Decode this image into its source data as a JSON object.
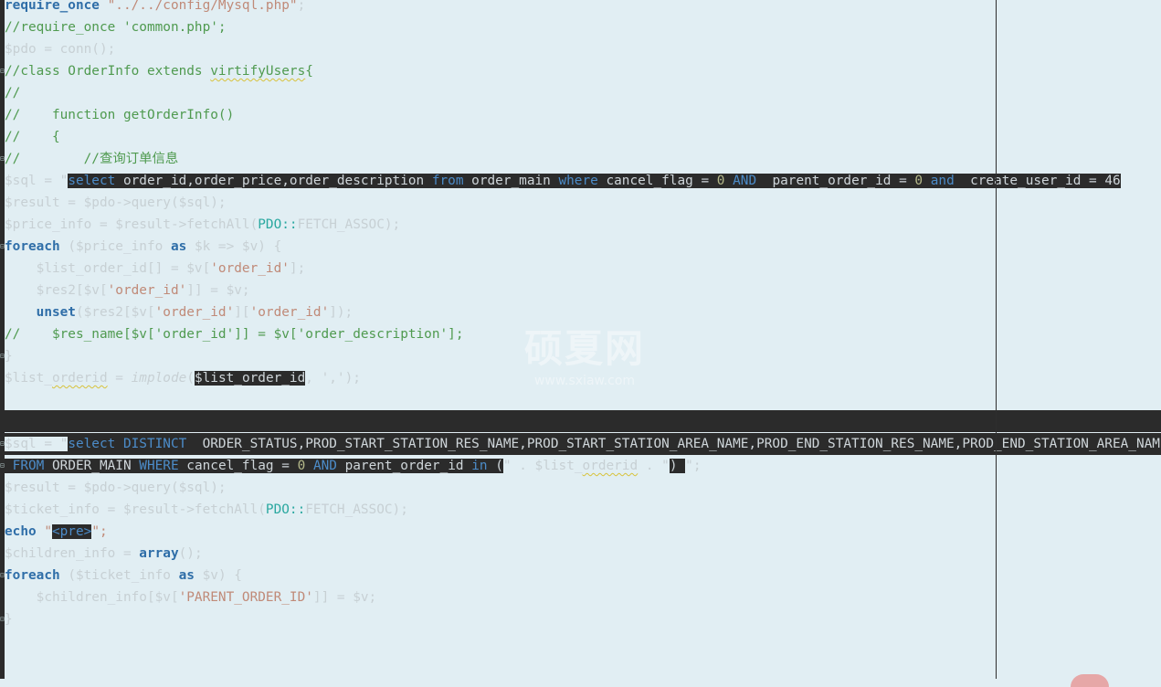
{
  "editor": {
    "language": "PHP",
    "lines": {
      "l1": {
        "kw": "require_once",
        "str": " \"../../config/Mysql.php\"",
        "end": ";"
      },
      "l2": {
        "comment": "//require_once 'common.php';"
      },
      "l3": {
        "text": "$pdo = conn();"
      },
      "l4": {
        "comment_a": "//class OrderInfo extends ",
        "comment_b": "virtifyUsers",
        "comment_c": "{"
      },
      "l5": {
        "comment": "//"
      },
      "l6": {
        "comment": "//    function getOrderInfo()"
      },
      "l7": {
        "comment": "//    {"
      },
      "l8": {
        "comment": "//        //查询订单信息"
      },
      "l9": {
        "pre": "$sql = \"",
        "sel_a": "select",
        "sel_b": " order_id,order_price,order_description ",
        "sel_c": "from",
        "sel_d": " order_main ",
        "sel_e": "where",
        "sel_f": " cancel_flag = ",
        "sel_g": "0",
        "sel_h": " ",
        "sel_i": "AND",
        "sel_j": "  parent_order_id = ",
        "sel_k": "0",
        "sel_l": " ",
        "sel_m": "and",
        "sel_n": "  create_user_id = 46"
      },
      "l10": {
        "a": "$result = $pdo->query($sql);"
      },
      "l11": {
        "a": "$price_info = $result->fetchAll(",
        "cls": "PDO::",
        "b": "FETCH_ASSOC);"
      },
      "l12": {
        "kw": "foreach",
        "a": " ($price_info ",
        "as": "as",
        "b": " $k => $v) {"
      },
      "l13": {
        "a": "    $list_order_id[] = $v[",
        "str": "'order_id'",
        "b": "];"
      },
      "l14": {
        "a": "    $res2[$v[",
        "str": "'order_id'",
        "b": "]] = $v;"
      },
      "l15": {
        "ind": "    ",
        "kw": "unset",
        "a": "($res2[$v[",
        "str1": "'order_id'",
        "b": "][",
        "str2": "'order_id'",
        "c": "]);"
      },
      "l16": {
        "comment": "//    $res_name[$v['order_id']] = $v['order_description'];"
      },
      "l17": {
        "text": "}"
      },
      "l18": {
        "a": "$list_",
        "sq": "orderid",
        "b": " = ",
        "fn": "implode",
        "c": "(",
        "sel": "$list_order_id",
        "d": ", ','",
        "e": ");"
      },
      "l20": {
        "pre": "$sql = \"",
        "sel_a": "select",
        "sel_b": " ",
        "sel_c": "DISTINCT",
        "sel_d": "  ORDER_STATUS,PROD_START_STATION_RES_NAME,PROD_START_STATION_AREA_NAME,PROD_END_STATION_RES_NAME,PROD_END_STATION_AREA_NAME"
      },
      "l21": {
        "sel_a": " ",
        "sel_b": "FROM",
        "sel_c": " ORDER_MAIN ",
        "sel_d": "WHERE",
        "sel_e": " cancel_flag = ",
        "sel_f": "0",
        "sel_g": " ",
        "sel_h": "AND",
        "sel_i": " parent_order_id ",
        "sel_j": "in",
        "sel_k": " (",
        "a": "\" . $list_",
        "sq": "orderid",
        "b": " . \"",
        "sel2": ") ",
        "c": "\";"
      },
      "l22": {
        "a": "$result = $pdo->query($sql);"
      },
      "l23": {
        "a": "$ticket_info = $result->fetchAll(",
        "cls": "PDO::",
        "b": "FETCH_ASSOC);"
      },
      "l24": {
        "kw": "echo",
        "a": " \"",
        "sel": "<pre>",
        "b": "\";"
      },
      "l25": {
        "a": "$children_info = ",
        "kw": "array",
        "b": "();"
      },
      "l26": {
        "kw": "foreach",
        "a": " ($ticket_info ",
        "as": "as",
        "b": " $v) {"
      },
      "l27": {
        "a": "    $children_info[$v[",
        "str": "'PARENT_ORDER_ID'",
        "b": "]] = $v;"
      },
      "l28": {
        "text": "}"
      }
    }
  },
  "watermark": {
    "title": "硕夏网",
    "url": "www.sxiaw.com"
  }
}
